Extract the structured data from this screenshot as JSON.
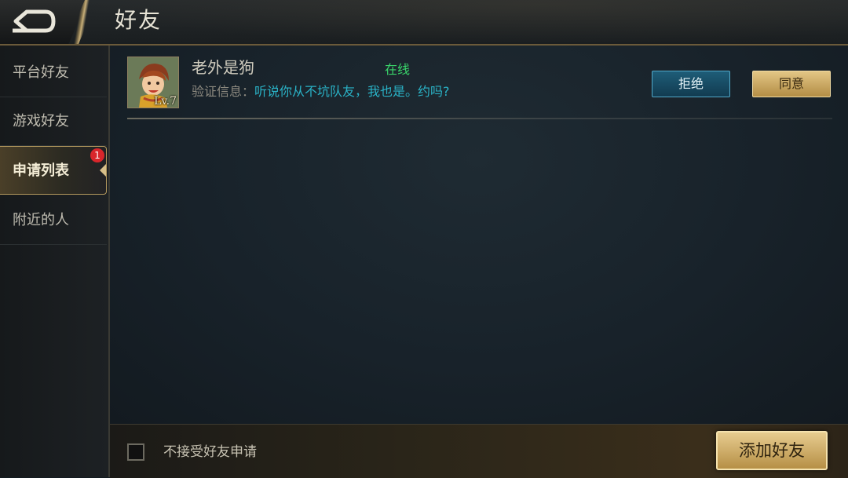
{
  "header": {
    "title": "好友",
    "back_icon": "back-arrow-icon"
  },
  "sidebar": {
    "items": [
      {
        "label": "平台好友",
        "active": false
      },
      {
        "label": "游戏好友",
        "active": false
      },
      {
        "label": "申请列表",
        "active": true,
        "badge": "1"
      },
      {
        "label": "附近的人",
        "active": false
      }
    ]
  },
  "request": {
    "name": "老外是狗",
    "status": "在线",
    "level": "Lv.7",
    "verify_label": "验证信息：",
    "verify_message": "听说你从不坑队友，我也是。约吗?",
    "reject_label": "拒绝",
    "accept_label": "同意"
  },
  "footer": {
    "checkbox_label": "不接受好友申请",
    "checkbox_checked": false,
    "add_friend_label": "添加好友"
  },
  "colors": {
    "accent_gold": "#c9a964",
    "online_green": "#39d56a",
    "message_cyan": "#2ab3c7",
    "badge_red": "#d9262b"
  }
}
